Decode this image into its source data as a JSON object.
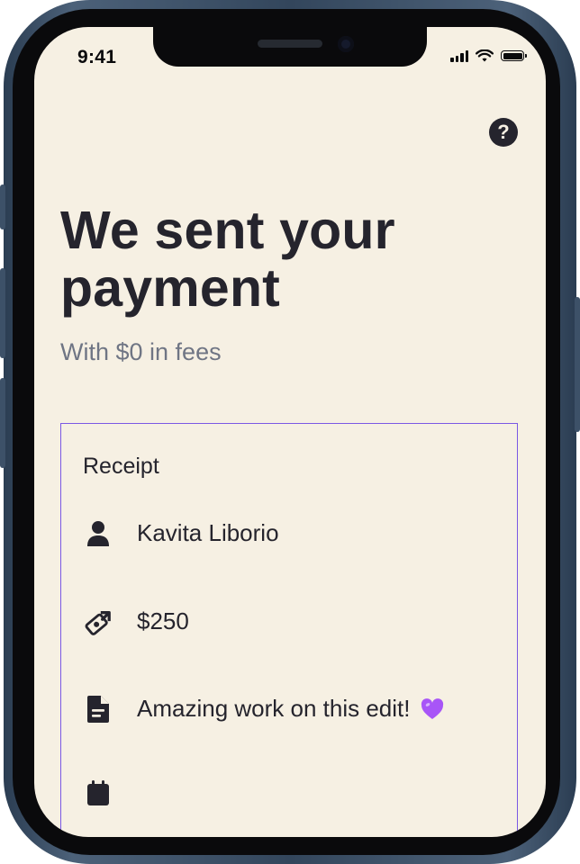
{
  "status_bar": {
    "time": "9:41"
  },
  "header": {
    "help_label": "?"
  },
  "main": {
    "title": "We sent your payment",
    "subtitle": "With $0 in fees"
  },
  "receipt": {
    "heading": "Receipt",
    "recipient_name": "Kavita Liborio",
    "amount": "$250",
    "note": "Amazing work on this edit!"
  },
  "colors": {
    "background": "#f6f0e3",
    "text": "#25242d",
    "subtext": "#6f7584",
    "card_border": "#7a58e4",
    "heart": "#a855f7"
  },
  "icons": {
    "recipient": "person-icon",
    "amount": "money-transfer-icon",
    "note": "document-icon",
    "heart": "purple-heart-icon"
  }
}
